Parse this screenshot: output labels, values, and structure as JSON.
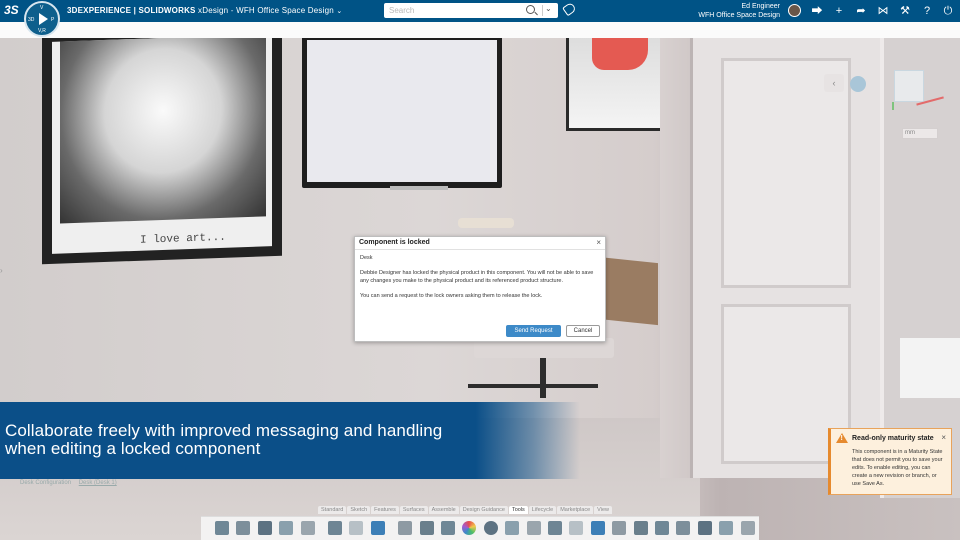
{
  "topbar": {
    "logo_text": "3S",
    "compass_labels": {
      "top": "V",
      "left": "3D",
      "right": "P",
      "bottom": "V,R"
    },
    "app_brand": "3DEXPERIENCE | SOLIDWORKS",
    "app_name": "xDesign",
    "sep": "-",
    "doc_name": "WFH Office Space Design",
    "chevron": "⌄",
    "search_placeholder": "Search",
    "search_chevron": "⌄",
    "user_name": "Ed Engineer",
    "user_context": "WFH Office Space Design",
    "right_icons": [
      "chat-icon",
      "add-icon",
      "share-icon",
      "share-nodes-icon",
      "tools-icon",
      "help-icon",
      "power-icon"
    ],
    "right_icon_glyphs": [
      "⮕",
      "+",
      "➦",
      "⋈",
      "⚒",
      "?",
      "⏻"
    ]
  },
  "viewport": {
    "picture_caption": "I love art...",
    "view_back_glyph": "‹",
    "unit_select_value": "mm"
  },
  "dialog": {
    "title": "Component is locked",
    "close_glyph": "×",
    "component": "Desk",
    "message": "Debbie Designer has locked the physical product in this component. You will not be able to save any changes you make to the physical product and its referenced product structure.",
    "hint": "You can send a request to the lock owners asking them to release the lock.",
    "primary_button": "Send Request",
    "cancel_button": "Cancel"
  },
  "banner": {
    "line1": "Collaborate freely with improved messaging and handling",
    "line2": "when editing a locked component"
  },
  "notification": {
    "title": "Read-only maturity state",
    "close_glyph": "×",
    "text": "This component is in a Maturity State that does not permit you to save your edits. To enable editing, you can create a new revision or branch, or use Save As."
  },
  "tree": {
    "item1": "Desk Configuration",
    "item2": "Desk (Desk 1)"
  },
  "actionbar": {
    "tabs": [
      "Standard",
      "Sketch",
      "Features",
      "Surfaces",
      "Assemble",
      "Design Guidance",
      "Tools",
      "Lifecycle",
      "Marketplace",
      "View"
    ],
    "active_tab": "Tools",
    "icon_names": [
      "new-icon",
      "open-icon",
      "save-icon",
      "properties-icon",
      "settings-icon",
      "undo-icon",
      "redo-icon",
      "help-icon",
      "measure-icon",
      "image-icon",
      "render-icon",
      "color-icon",
      "zoom-icon",
      "balance-icon",
      "section-icon",
      "texture-icon",
      "align-icon",
      "explode-icon",
      "mass-icon",
      "bom-icon",
      "simulation-icon",
      "publish-icon",
      "rule-icon",
      "drawing-icon",
      "export-icon"
    ],
    "colors": {
      "accent": "#005386",
      "primary_button": "#3d8ac8",
      "warning": "#e68a2e",
      "banner": "#0b4f88"
    }
  }
}
